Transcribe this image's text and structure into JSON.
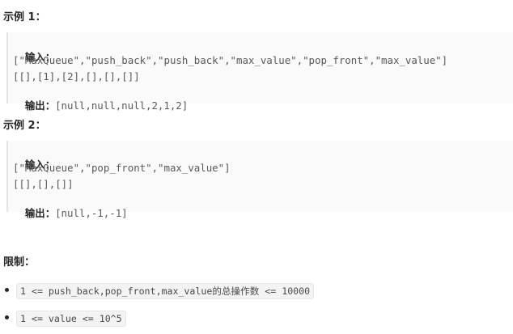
{
  "example1": {
    "heading": "示例 1：",
    "input_label": "输入：",
    "ops": "[\"MaxQueue\",\"push_back\",\"push_back\",\"max_value\",\"pop_front\",\"max_value\"]",
    "args": "[[],[1],[2],[],[],[]]",
    "output_label": "输出：",
    "output": "[null,null,null,2,1,2]"
  },
  "example2": {
    "heading": "示例 2：",
    "input_label": "输入：",
    "ops": "[\"MaxQueue\",\"pop_front\",\"max_value\"]",
    "args": "[[],[],[]]",
    "output_label": "输出：",
    "output": "[null,-1,-1]"
  },
  "limits": {
    "heading": "限制：",
    "items": [
      "1 <= push_back,pop_front,max_value的总操作数 <= 10000",
      "1 <= value <= 10^5"
    ]
  }
}
